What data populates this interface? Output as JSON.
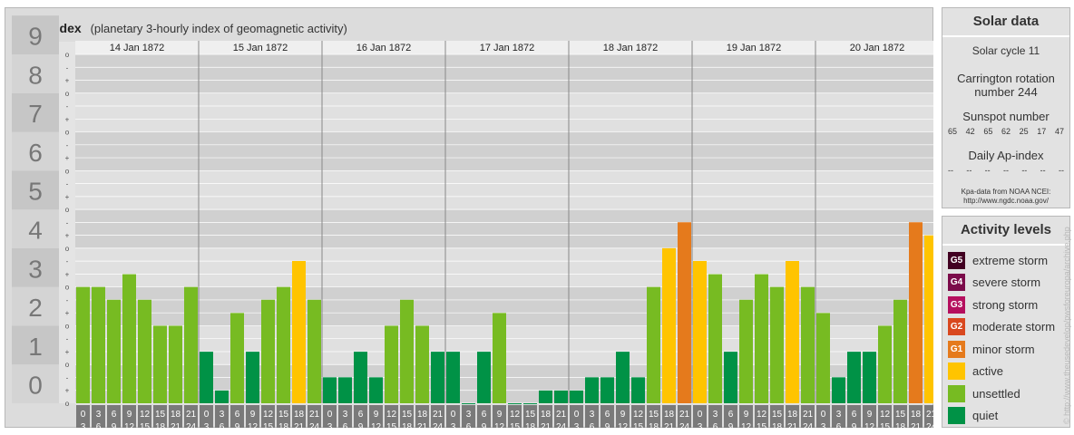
{
  "header": {
    "title": "Kpa-index",
    "subtitle": "(planetary 3-hourly index of geomagnetic activity)"
  },
  "colors": {
    "quiet": "#009246",
    "unsettled": "#77bb22",
    "active": "#ffc400",
    "g1": "#e57a1c",
    "g2": "#d9481f",
    "g3": "#b50f5e",
    "g4": "#7b0b4a",
    "g5": "#420022"
  },
  "chart_data": {
    "type": "bar",
    "y_tick_labels": [
      "0",
      "1",
      "2",
      "3",
      "4",
      "5",
      "6",
      "7",
      "8",
      "9"
    ],
    "ylim": [
      0,
      9
    ],
    "minor_tick_labels": [
      "o",
      "+",
      "-"
    ],
    "days": [
      "14 Jan 1872",
      "15 Jan 1872",
      "16 Jan 1872",
      "17 Jan 1872",
      "18 Jan 1872",
      "19 Jan 1872",
      "20 Jan 1872"
    ],
    "hour_labels_top": [
      "0",
      "3",
      "6",
      "9",
      "12",
      "15",
      "18",
      "21"
    ],
    "hour_labels_bottom": [
      "3",
      "6",
      "9",
      "12",
      "15",
      "18",
      "21",
      "24"
    ],
    "values": [
      3,
      3,
      2.67,
      3.33,
      2.67,
      2,
      2,
      3,
      1.33,
      0.33,
      2.33,
      1.33,
      2.67,
      3,
      3.67,
      2.67,
      0.67,
      0.67,
      1.33,
      0.67,
      2,
      2.67,
      2,
      1.33,
      1.33,
      0,
      1.33,
      2.33,
      0,
      0,
      0.33,
      0.33,
      0.33,
      0.67,
      0.67,
      1.33,
      0.67,
      3,
      4,
      4.67,
      3.67,
      3.33,
      1.33,
      2.67,
      3.33,
      3,
      3.67,
      3,
      2.33,
      0.67,
      1.33,
      1.33,
      2,
      2.67,
      4.67,
      4.33
    ]
  },
  "solar_panel": {
    "header": "Solar data",
    "solar_cycle": "Solar cycle 11",
    "carrington_line1": "Carrington rotation",
    "carrington_line2": "number 244",
    "sunspot_label": "Sunspot number",
    "sunspot_values": [
      "65",
      "42",
      "65",
      "62",
      "25",
      "17",
      "47"
    ],
    "ap_label": "Daily Ap-index",
    "ap_values": [
      "--",
      "--",
      "--",
      "--",
      "--",
      "--",
      "--"
    ],
    "source_line1": "Kpa-data from NOAA NCEI:",
    "source_line2": "http://www.ngdc.noaa.gov/"
  },
  "activity_panel": {
    "header": "Activity levels",
    "levels": [
      {
        "badge": "G5",
        "label": "extreme storm",
        "color": "#420022"
      },
      {
        "badge": "G4",
        "label": "severe storm",
        "color": "#7b0b4a"
      },
      {
        "badge": "G3",
        "label": "strong storm",
        "color": "#b50f5e"
      },
      {
        "badge": "G2",
        "label": "moderate storm",
        "color": "#d9481f"
      },
      {
        "badge": "G1",
        "label": "minor storm",
        "color": "#e57a1c"
      },
      {
        "badge": "",
        "label": "active",
        "color": "#ffc400"
      },
      {
        "badge": "",
        "label": "unsettled",
        "color": "#77bb22"
      },
      {
        "badge": "",
        "label": "quiet",
        "color": "#009246"
      }
    ]
  },
  "watermark": "© http://www.theusedevelop/pwsforeuropa/archive.php"
}
